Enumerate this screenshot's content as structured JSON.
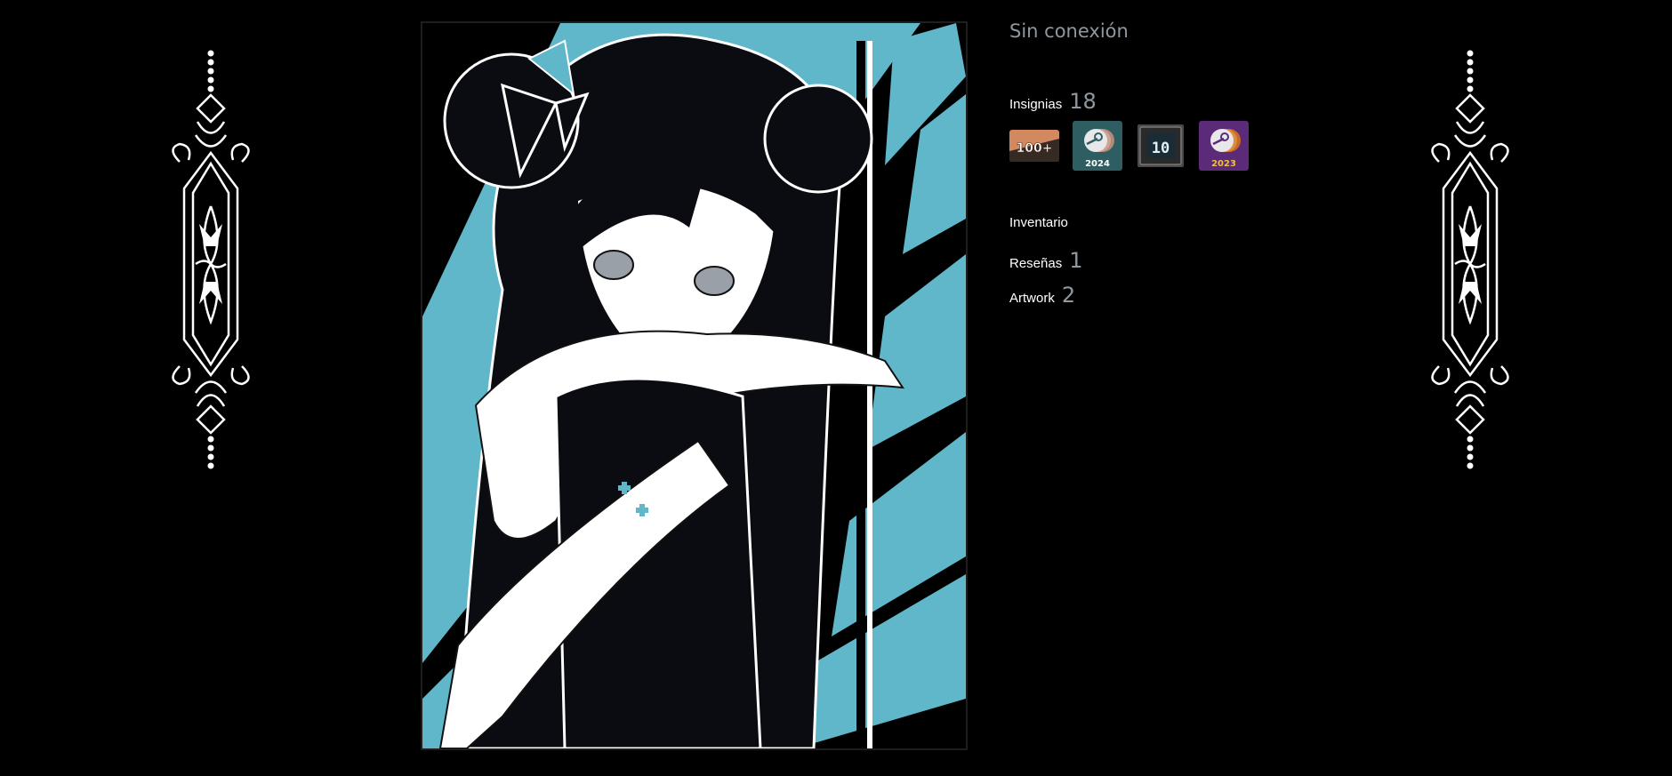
{
  "profile": {
    "status": "Sin conexión",
    "badges": {
      "label": "Insignias",
      "count": "18",
      "items": [
        {
          "name": "badge-100-plus",
          "text": "100+"
        },
        {
          "name": "badge-steam-2024",
          "text": "2024"
        },
        {
          "name": "badge-years-10",
          "text": "10"
        },
        {
          "name": "badge-steam-2023",
          "text": "2023"
        }
      ]
    },
    "links": [
      {
        "label": "Inventario",
        "count": ""
      },
      {
        "label": "Reseñas",
        "count": "1"
      },
      {
        "label": "Artwork",
        "count": "2"
      }
    ]
  },
  "colors": {
    "background": "#000000",
    "status_text": "#8f98a0",
    "label_text": "#ffffff",
    "artwork_accent": "#5fb7c9"
  },
  "icons": [
    "ornament-left-icon",
    "ornament-right-icon",
    "steam-logo-icon"
  ]
}
